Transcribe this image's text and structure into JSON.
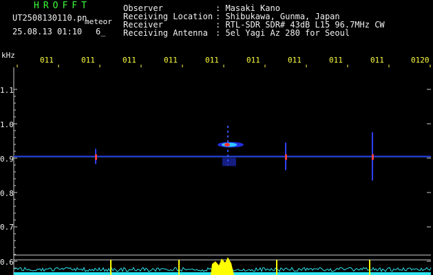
{
  "header": {
    "logo_text": "HROFFT",
    "filename": "UT2508130110.pn",
    "mode": "meteor",
    "datetime": "25.08.13 01:10",
    "counter": "6_",
    "labels": [
      "Observer",
      "Receiving Location",
      "Receiver",
      "Receiving Antenna"
    ],
    "values": [
      ": Masaki Kano",
      ": Shibukawa, Gunma, Japan",
      ": RTL-SDR SDR# 43dB L15 96.7MHz CW",
      ": 5el Yagi Az 280 for Seoul"
    ]
  },
  "chart_data": {
    "type": "heatmap",
    "yunit": "kHz",
    "yticks": [
      "1.1",
      "1.0",
      "0.9",
      "0.8",
      "0.7",
      "0.6"
    ],
    "xticks": [
      "011",
      "011",
      "011",
      "011",
      "011",
      "011",
      "011",
      "011",
      "011",
      "0120"
    ],
    "carrier_khz": 0.905,
    "events": [
      {
        "time_min": 1.9,
        "label": "short ping"
      },
      {
        "time_min": 5.1,
        "label": "meteor head echo"
      },
      {
        "time_min": 6.5,
        "label": "ping"
      },
      {
        "time_min": 8.6,
        "label": "ping"
      }
    ],
    "colors": {
      "background": "#000000",
      "carrier": "#2a3cff",
      "grid": "#cfcfcf",
      "spectrum": "#2fe6f0",
      "peak": "#ffff00"
    }
  }
}
